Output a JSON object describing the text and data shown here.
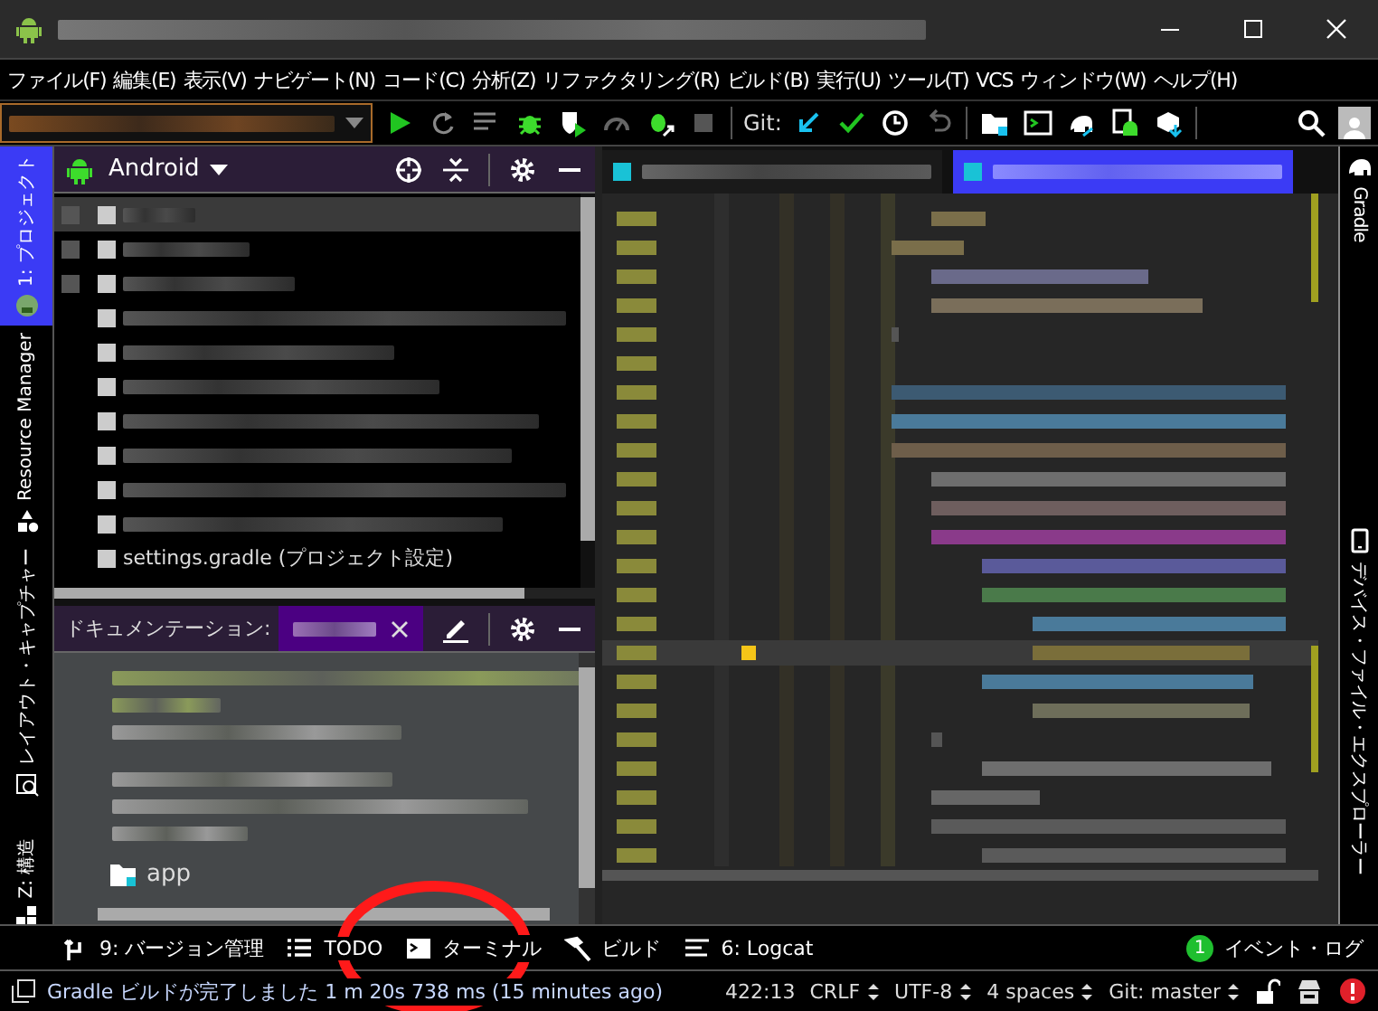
{
  "menu": [
    "ファイル(F)",
    "編集(E)",
    "表示(V)",
    "ナビゲート(N)",
    "コード(C)",
    "分析(Z)",
    "リファクタリング(R)",
    "ビルド(B)",
    "実行(U)",
    "ツール(T)",
    "VCS",
    "ウィンドウ(W)",
    "ヘルプ(H)"
  ],
  "toolbar": {
    "git_label": "Git:"
  },
  "left_stripe": [
    {
      "label": "1: プロジェクト",
      "kind": "project",
      "selected": true
    },
    {
      "label": "Resource Manager",
      "kind": "resources",
      "selected": false
    },
    {
      "label": "レイアウト・キャプチャー",
      "kind": "layout",
      "selected": false
    },
    {
      "label": "Z: 構造",
      "kind": "structure",
      "selected": false
    }
  ],
  "project_panel": {
    "view": "Android",
    "tree": [
      {
        "blurred": true,
        "selected": true
      },
      {
        "blurred": true,
        "selected": false
      },
      {
        "blurred": true,
        "selected": false,
        "children": [
          {
            "blurred": true,
            "selected": false
          },
          {
            "blurred": true,
            "selected": false
          },
          {
            "blurred": true,
            "selected": false
          },
          {
            "blurred": true,
            "selected": false
          },
          {
            "blurred": true,
            "selected": false
          },
          {
            "blurred": true,
            "selected": false
          },
          {
            "blurred": true,
            "selected": false
          },
          {
            "label": "settings.gradle (プロジェクト設定)",
            "blurred": false,
            "selected": false
          }
        ]
      }
    ]
  },
  "documentation": {
    "title": "ドキュメンテーション:",
    "folder": "app"
  },
  "editor": {
    "tabs": [
      {
        "selected": false
      },
      {
        "selected": true
      }
    ]
  },
  "right_stripe": [
    {
      "label": "Gradle",
      "kind": "gradle"
    },
    {
      "label": "デバイス・ファイル・エクスプローラー",
      "kind": "device"
    }
  ],
  "tool_strip": [
    {
      "label": "9: バージョン管理",
      "kind": "vcs"
    },
    {
      "label": "TODO",
      "kind": "todo"
    },
    {
      "label": "ターミナル",
      "kind": "terminal"
    },
    {
      "label": "ビルド",
      "kind": "build"
    },
    {
      "label": "6: Logcat",
      "kind": "logcat"
    }
  ],
  "event_log": {
    "count": "1",
    "label": "イベント・ログ"
  },
  "status": {
    "message": "Gradle ビルドが完了しました 1 m 20s 738 ms (15 minutes ago)",
    "position": "422:13",
    "line_separator": "CRLF",
    "encoding": "UTF-8",
    "indent": "4 spaces",
    "branch": "Git: master"
  }
}
